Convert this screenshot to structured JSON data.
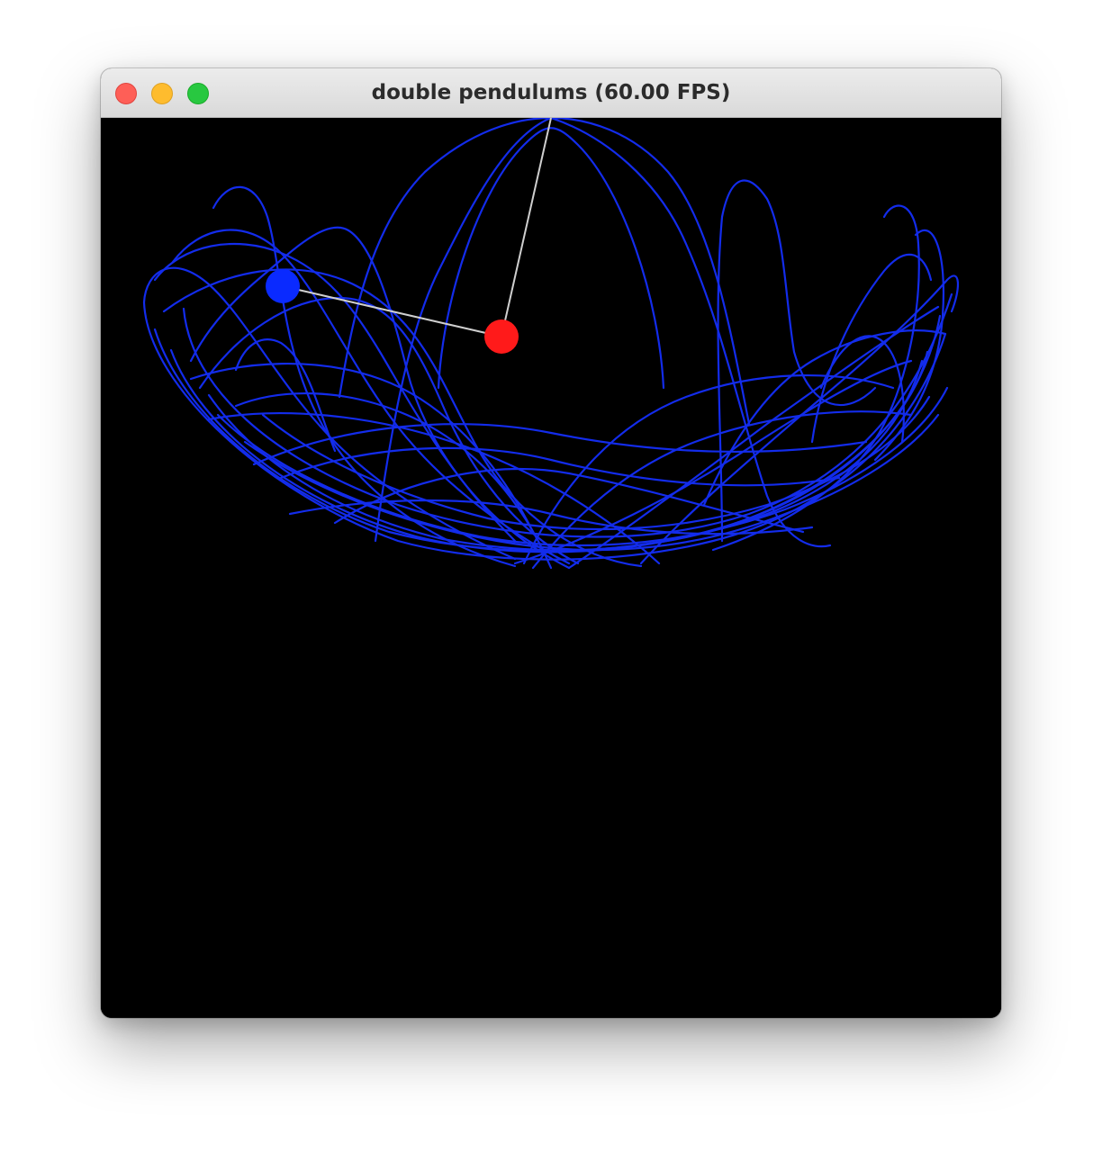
{
  "window": {
    "title": "double pendulums (60.00 FPS)"
  },
  "traffic_lights": {
    "close_color": "#fe5f57",
    "minimize_color": "#febc2e",
    "zoom_color": "#28c840"
  },
  "scene": {
    "background": "#000000",
    "trail_color": "#1530ff",
    "rod_color": "#cfcfcf",
    "bob1_color": "#ff1a1a",
    "bob2_color": "#0a2aff"
  }
}
